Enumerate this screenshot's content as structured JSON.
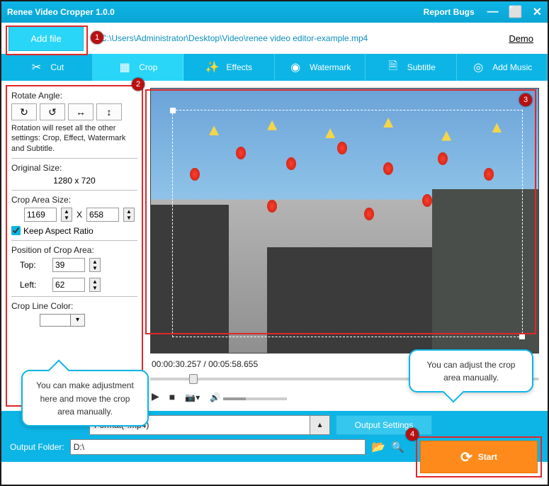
{
  "window": {
    "title": "Renee Video Cropper 1.0.0",
    "report": "Report Bugs",
    "min": "—",
    "max": "⬜",
    "close": "✕"
  },
  "top": {
    "addfile": "Add file",
    "path": "C:\\Users\\Administrator\\Desktop\\Video\\renee video editor-example.mp4",
    "demo": "Demo"
  },
  "tabs": {
    "cut": "Cut",
    "crop": "Crop",
    "effects": "Effects",
    "watermark": "Watermark",
    "subtitle": "Subtitle",
    "addmusic": "Add Music"
  },
  "side": {
    "rotate_label": "Rotate Angle:",
    "rot_note": "Rotation will reset all the other settings: Crop, Effect, Watermark and Subtitle.",
    "orig_label": "Original Size:",
    "orig_val": "1280 x 720",
    "area_label": "Crop Area Size:",
    "w": "1169",
    "x": "X",
    "h": "658",
    "keep": "Keep Aspect Ratio",
    "pos_label": "Position of Crop Area:",
    "top_l": "Top:",
    "top_v": "39",
    "left_l": "Left:",
    "left_v": "62",
    "color_label": "Crop Line Color:"
  },
  "preview": {
    "time": "00:00:30.257 / 00:05:58.655"
  },
  "bottom": {
    "format": "Format(*.mp4)",
    "outsettings": "Output Settings",
    "start": "Start",
    "folder_label": "Output Folder:",
    "folder": "D:\\"
  },
  "badges": {
    "b1": "1",
    "b2": "2",
    "b3": "3",
    "b4": "4"
  },
  "callouts": {
    "left": "You can make adjustment here and move the crop area manually.",
    "right": "You can adjust the crop area manually."
  },
  "icons": {
    "cut": "✂",
    "crop": "▦",
    "effects": "✨",
    "watermark": "◉",
    "subtitle": "🗎",
    "music": "◎",
    "play": "▶",
    "stop": "■",
    "cam": "📷",
    "dd": "▾",
    "vol": "🔊",
    "cycle": "⟳",
    "browse": "📂",
    "search": "🔍",
    "rot_cw": "↻",
    "rot_ccw": "↺",
    "flip_h": "↔",
    "flip_v": "↕"
  }
}
